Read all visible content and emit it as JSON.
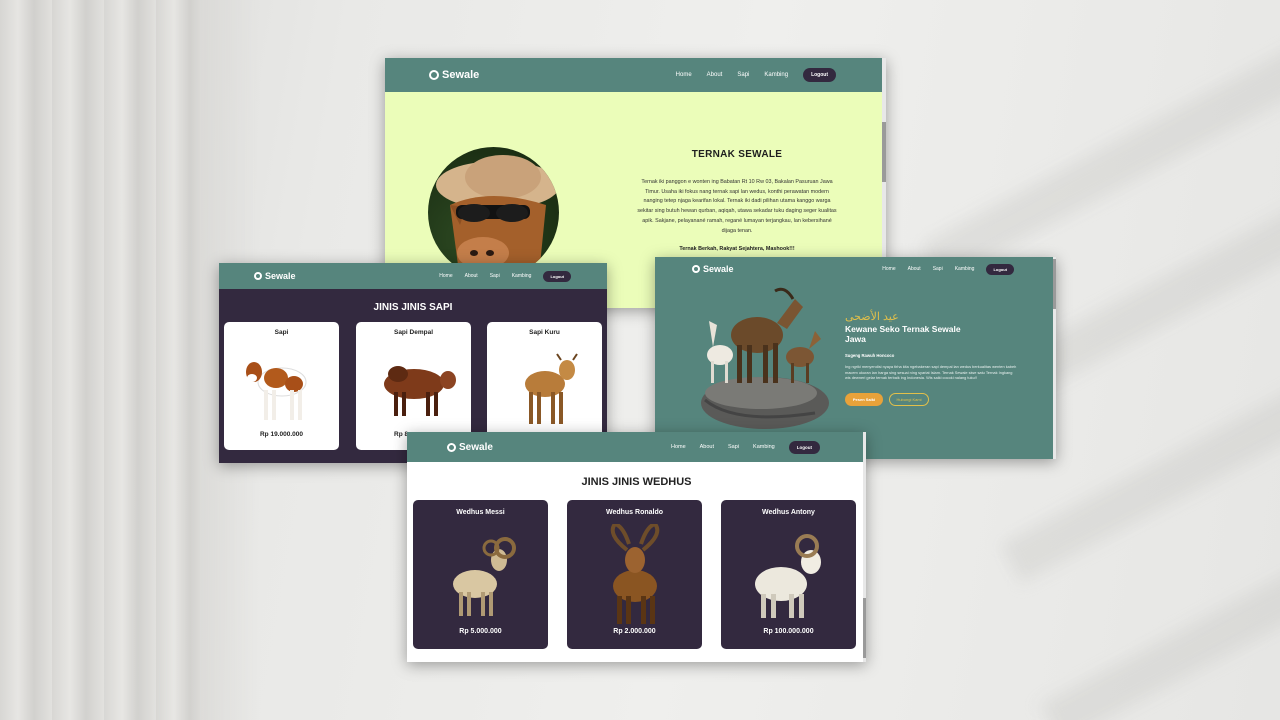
{
  "brand": "Sewale",
  "nav": {
    "home": "Home",
    "about": "About",
    "sapi": "Sapi",
    "kambing": "Kambing",
    "logout": "Logout"
  },
  "about": {
    "title": "TERNAK SEWALE",
    "body": "Ternak iki panggon e wonten ing Babatan Rt 10 Rw 03, Bakalan Pasuruan Jawa Timur. Usaha iki fokus nang ternak sapi lan wedus, konthi perawatan modern nanging tetep njaga kearifan lokal. Ternak iki dadi pilihan utama kanggo warga sekitar sing butuh hewan qurban, aqiqah, utawa sekadar tuku daging seger kualitas apik. Sakjane, pelayanané ramah, regané lumayan terjangkau, lan kebersihané dijaga tenan.",
    "tagline": "Ternak Berkah, Rakyat Sejahtera, Mashook!!!"
  },
  "sapi": {
    "heading": "JINIS JINIS SAPI",
    "items": [
      {
        "name": "Sapi",
        "price": "Rp 19.000.000"
      },
      {
        "name": "Sapi Dempal",
        "price": "Rp 8"
      },
      {
        "name": "Sapi Kuru",
        "price": ""
      }
    ]
  },
  "hero": {
    "arabic": "عيد الأضحى",
    "title_line1": "Kewane Seko Ternak Sewale",
    "title_line2": "Jawa",
    "subtitle": "Sugeng Rawuh Honcoco",
    "body": "Ing ngriki menyendisi nyaya tirha kita ngebakeran sapi dempal lan wedus berkualitas wenten kabeh macem ukuran lan harga sing sesuai ning syariat Islam. Ternak Sewale siwe satu Ternak Ingkang wis dewneri gelar ternak terbaik ing Indonesia. Wis saiki cocoki nalang tuku!!",
    "btn_primary": "Pesen Saiki",
    "btn_secondary": "Hubungi Kami"
  },
  "wedhus": {
    "heading": "JINIS JINIS WEDHUS",
    "items": [
      {
        "name": "Wedhus Messi",
        "price": "Rp 5.000.000"
      },
      {
        "name": "Wedhus Ronaldo",
        "price": "Rp 2.000.000"
      },
      {
        "name": "Wedhus Antony",
        "price": "Rp 100.000.000"
      }
    ]
  },
  "colors": {
    "nav_teal": "#56857d",
    "dark_purple": "#33293f",
    "about_bg": "#ebfdb9",
    "accent_orange": "#e8a23a",
    "hero_gold": "#e2c04a"
  }
}
